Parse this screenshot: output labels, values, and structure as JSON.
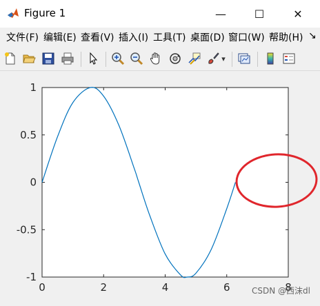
{
  "window": {
    "title": "Figure 1",
    "minimize_glyph": "—",
    "maximize_glyph": "☐",
    "close_glyph": "✕"
  },
  "menu": {
    "items": [
      {
        "label": "文件(F)"
      },
      {
        "label": "编辑(E)"
      },
      {
        "label": "查看(V)"
      },
      {
        "label": "插入(I)"
      },
      {
        "label": "工具(T)"
      },
      {
        "label": "桌面(D)"
      },
      {
        "label": "窗口(W)"
      },
      {
        "label": "帮助(H)"
      }
    ],
    "overflow_glyph": "↘"
  },
  "toolbar": {
    "icons": [
      "new-figure-icon",
      "open-folder-icon",
      "save-icon",
      "print-icon",
      "edit-pointer-icon",
      "zoom-in-icon",
      "zoom-out-icon",
      "pan-hand-icon",
      "rotate-3d-icon",
      "data-cursor-icon",
      "brush-icon",
      "brush-dropdown-icon",
      "link-plot-icon",
      "colorbar-icon",
      "legend-icon"
    ],
    "dropdown_glyph": "▾"
  },
  "chart_data": {
    "type": "line",
    "series": [
      {
        "x": [
          0,
          0.5,
          1,
          1.5708,
          2,
          2.5,
          3,
          3.1416,
          3.5,
          4,
          4.5,
          4.7124,
          5,
          5.5,
          6,
          6.2832
        ],
        "values": [
          0,
          0.479,
          0.841,
          1,
          0.909,
          0.598,
          0.141,
          0,
          -0.351,
          -0.757,
          -0.978,
          -1,
          -0.959,
          -0.706,
          -0.279,
          0
        ]
      }
    ],
    "xlim": [
      0,
      8
    ],
    "ylim": [
      -1,
      1
    ],
    "xticks": [
      0,
      2,
      4,
      6,
      8
    ],
    "yticks": [
      1,
      0.5,
      0,
      -0.5,
      -1
    ],
    "xtick_labels": [
      "0",
      "2",
      "4",
      "6",
      "8"
    ],
    "ytick_labels": [
      "1",
      "0.5",
      "0",
      "-0.5",
      "-1"
    ],
    "line_color": "#0072bd",
    "annotation_color": "#e0262c"
  },
  "watermark": "CSDN @西沫dl"
}
